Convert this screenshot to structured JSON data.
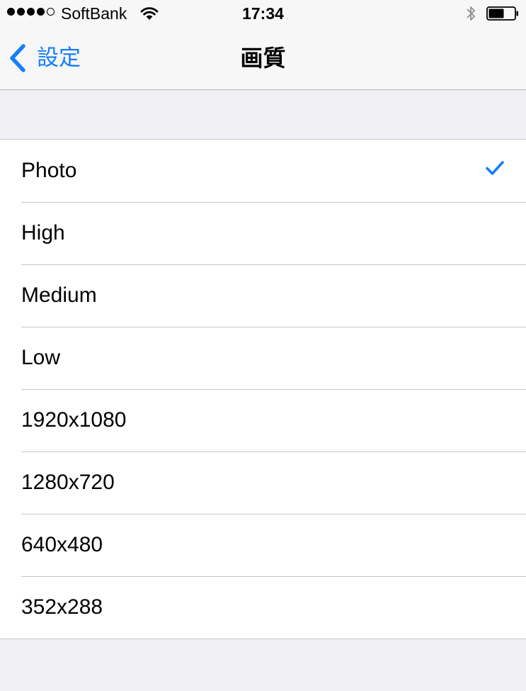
{
  "status_bar": {
    "carrier": "SoftBank",
    "time": "17:34",
    "signal_bars_filled": 4,
    "signal_bars_total": 5,
    "battery_level": 0.6,
    "icons": [
      "wifi-icon",
      "bluetooth-icon",
      "battery-icon"
    ]
  },
  "nav": {
    "back_label": "設定",
    "title": "画質"
  },
  "options": [
    {
      "label": "Photo",
      "selected": true
    },
    {
      "label": "High",
      "selected": false
    },
    {
      "label": "Medium",
      "selected": false
    },
    {
      "label": "Low",
      "selected": false
    },
    {
      "label": "1920x1080",
      "selected": false
    },
    {
      "label": "1280x720",
      "selected": false
    },
    {
      "label": "640x480",
      "selected": false
    },
    {
      "label": "352x288",
      "selected": false
    }
  ],
  "colors": {
    "accent": "#157efb",
    "background": "#efeff4",
    "bar_background": "#f7f7f7",
    "separator": "#c8c7cc"
  }
}
